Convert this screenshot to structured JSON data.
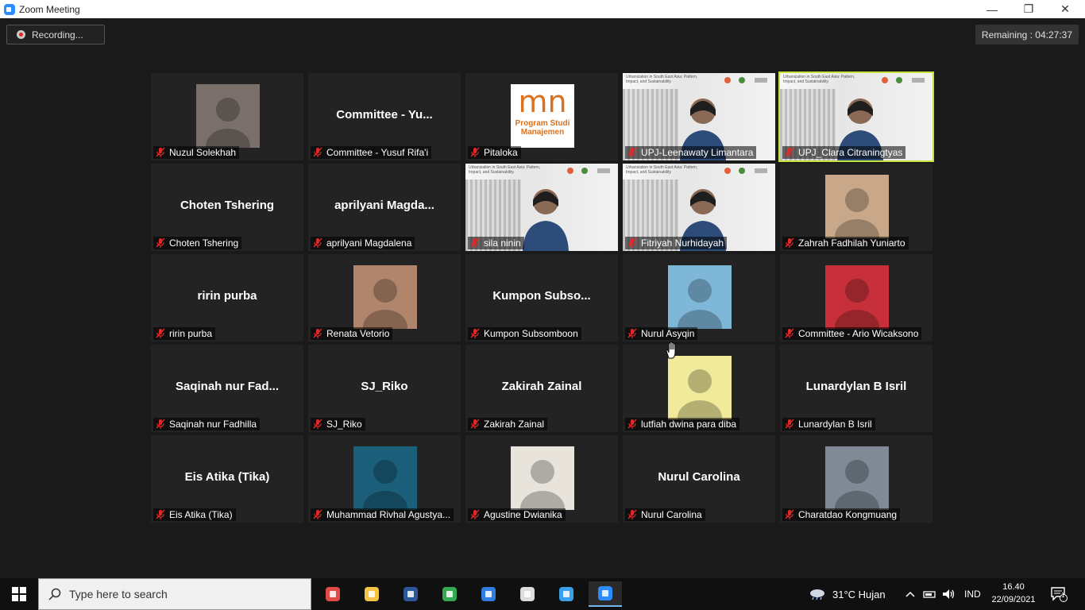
{
  "window": {
    "title": "Zoom Meeting",
    "controls": {
      "minimize": "—",
      "restore": "❐",
      "close": "✕"
    }
  },
  "meeting": {
    "recording_label": "Recording...",
    "remaining_label": "Remaining : 04:27:37"
  },
  "slide_header": "Urbanization in South East Asia: Pattern, Impact, and Sustainability",
  "participants": [
    {
      "name": "Nuzul Solekhah",
      "display": "",
      "type": "photo",
      "color": "#7a6f6a"
    },
    {
      "name": "Committee - Yusuf Rifa'i",
      "display": "Committee - Yu...",
      "type": "name"
    },
    {
      "name": "Pitaloka",
      "display": "",
      "type": "logo",
      "logo_text": "mn",
      "logo_sub": "Program Studi Manajemen"
    },
    {
      "name": "UPJ-Leenawaty Limantara",
      "display": "",
      "type": "video"
    },
    {
      "name": "UPJ_Clara Citraningtyas",
      "display": "",
      "type": "video",
      "active": true
    },
    {
      "name": "Choten Tshering",
      "display": "Choten Tshering",
      "type": "name"
    },
    {
      "name": "aprilyani Magdalena",
      "display": "aprilyani Magda...",
      "type": "name"
    },
    {
      "name": "sila ninin",
      "display": "",
      "type": "video"
    },
    {
      "name": "Fitriyah Nurhidayah",
      "display": "",
      "type": "video"
    },
    {
      "name": "Zahrah Fadhilah Yuniarto",
      "display": "",
      "type": "photo",
      "color": "#c9a88a"
    },
    {
      "name": "ririn purba",
      "display": "ririn purba",
      "type": "name"
    },
    {
      "name": "Renata Vetorio",
      "display": "",
      "type": "photo",
      "color": "#b0856c"
    },
    {
      "name": "Kumpon Subsomboon",
      "display": "Kumpon Subso...",
      "type": "name"
    },
    {
      "name": "Nurul Asyqin",
      "display": "",
      "type": "photo",
      "color": "#7fb7d9"
    },
    {
      "name": "Committee - Ario Wicaksono",
      "display": "",
      "type": "photo",
      "color": "#c7303a"
    },
    {
      "name": "Saqinah nur Fadhilla",
      "display": "Saqinah nur Fad...",
      "type": "name"
    },
    {
      "name": "SJ_Riko",
      "display": "SJ_Riko",
      "type": "name"
    },
    {
      "name": "Zakirah Zainal",
      "display": "Zakirah Zainal",
      "type": "name"
    },
    {
      "name": "lutfiah dwina para diba",
      "display": "",
      "type": "photo",
      "color": "#f1ea9a"
    },
    {
      "name": "Lunardylan B Isril",
      "display": "Lunardylan B Isril",
      "type": "name"
    },
    {
      "name": "Eis Atika (Tika)",
      "display": "Eis Atika (Tika)",
      "type": "name"
    },
    {
      "name": "Muhammad Rivhal Agustya...",
      "display": "",
      "type": "photo",
      "color": "#1b5f7a"
    },
    {
      "name": "Agustine Dwianika",
      "display": "",
      "type": "photo",
      "color": "#e8e4dc"
    },
    {
      "name": "Nurul Carolina",
      "display": "Nurul Carolina",
      "type": "name"
    },
    {
      "name": "Charatdao Kongmuang",
      "display": "",
      "type": "photo",
      "color": "#7f8a96"
    }
  ],
  "taskbar": {
    "search_placeholder": "Type here to search",
    "weather": "31°C  Hujan",
    "language": "IND",
    "time": "16.40",
    "date": "22/09/2021",
    "notification_count": "1",
    "apps": [
      {
        "name": "paint-app-icon",
        "color": "#e24a4a"
      },
      {
        "name": "file-explorer-icon",
        "color": "#f4c542"
      },
      {
        "name": "word-icon",
        "color": "#2b579a"
      },
      {
        "name": "chrome-icon",
        "color": "#34a853"
      },
      {
        "name": "document-app-icon",
        "color": "#2f7de1"
      },
      {
        "name": "obs-icon",
        "color": "#dddddd"
      },
      {
        "name": "vscode-icon",
        "color": "#3aa0ea"
      },
      {
        "name": "zoom-icon",
        "color": "#2d8cff"
      }
    ]
  },
  "colors": {
    "active_speaker": "#c5e33a",
    "muted_mic": "#e02828",
    "zoom_blue": "#2d8cff"
  }
}
